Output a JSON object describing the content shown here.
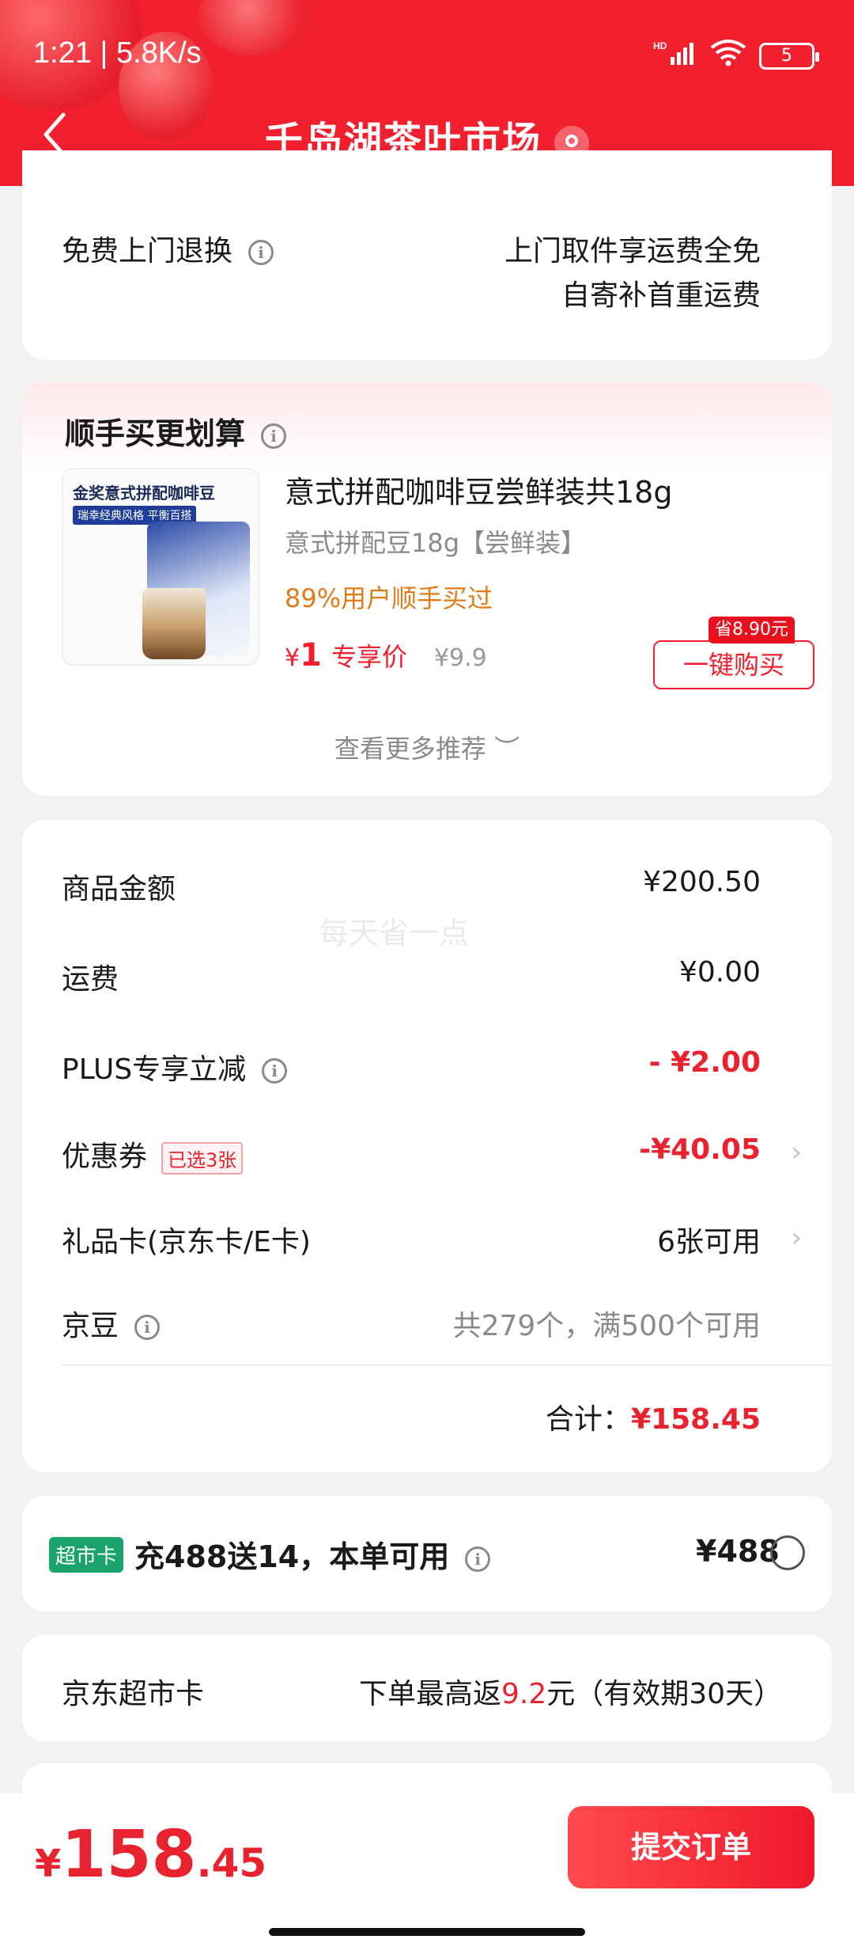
{
  "status_bar": {
    "time": "1:21 | 5.8K/s",
    "signal": "HD",
    "wifi": "wifi-6",
    "battery": "5"
  },
  "header": {
    "title": "千岛湖茶叶市场"
  },
  "service": {
    "label": "免费上门退换",
    "desc_line1": "上门取件享运费全免",
    "desc_line2": "自寄补首重运费"
  },
  "recommend": {
    "title": "顺手买更划算",
    "image_title": "金奖意式拼配咖啡豆",
    "image_tag": "瑞幸经典风格  平衡百搭",
    "product_name": "意式拼配咖啡豆尝鲜装共18g",
    "spec": "意式拼配豆18g【尝鲜装】",
    "bought": "89%用户顺手买过",
    "price_symbol": "¥",
    "price": "1",
    "price_tag": "专享价",
    "original_price": "¥9.9",
    "save_badge": "省8.90元",
    "buy_label": "一键购买",
    "more_link": "查看更多推荐 ︶"
  },
  "amounts": {
    "watermark": "每天省一点",
    "goods_label": "商品金额",
    "goods_value": "¥200.50",
    "shipping_label": "运费",
    "shipping_value": "¥0.00",
    "plus_label": "PLUS专享立减",
    "plus_value": "- ¥2.00",
    "coupon_label": "优惠券",
    "coupon_badge": "已选3张",
    "coupon_value": "-¥40.05",
    "giftcard_label": "礼品卡(京东卡/E卡)",
    "giftcard_value": "6张可用",
    "jingdou_label": "京豆",
    "jingdou_value": "共279个，满500个可用",
    "total_label": "合计：",
    "total_value": "¥158.45"
  },
  "supermarket_card": {
    "badge": "超市卡",
    "text": "充488送14，本单可用",
    "price": "¥488"
  },
  "jd_card": {
    "label": "京东超市卡",
    "desc_prefix": "下单最高返",
    "desc_amount": "9.2",
    "desc_suffix": "元（有效期30天）"
  },
  "bottom_bar": {
    "symbol": "¥",
    "integer": "158",
    "decimal": ".45",
    "submit_label": "提交订单"
  },
  "colors": {
    "brand_red": "#f2202e",
    "price_red": "#e8232f",
    "orange": "#e07b17",
    "green_badge": "#1aa36b"
  }
}
